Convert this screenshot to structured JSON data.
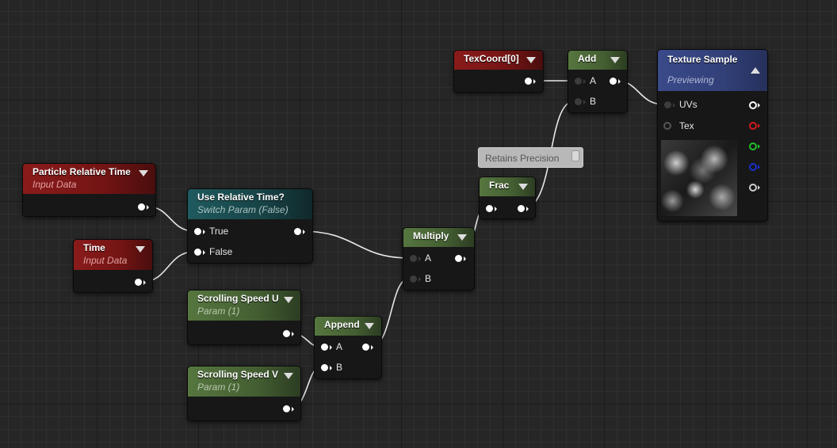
{
  "nodes": {
    "particle_relative_time": {
      "title": "Particle Relative Time",
      "subtitle": "Input Data"
    },
    "time": {
      "title": "Time",
      "subtitle": "Input Data"
    },
    "use_relative_time": {
      "title": "Use Relative Time?",
      "subtitle": "Switch Param (False)",
      "pin_true": "True",
      "pin_false": "False"
    },
    "scrolling_speed_u": {
      "title": "Scrolling Speed U",
      "subtitle": "Param (1)"
    },
    "scrolling_speed_v": {
      "title": "Scrolling Speed V",
      "subtitle": "Param (1)"
    },
    "append": {
      "title": "Append",
      "pin_a": "A",
      "pin_b": "B"
    },
    "multiply": {
      "title": "Multiply",
      "pin_a": "A",
      "pin_b": "B"
    },
    "frac": {
      "title": "Frac"
    },
    "texcoord": {
      "title": "TexCoord[0]"
    },
    "add": {
      "title": "Add",
      "pin_a": "A",
      "pin_b": "B"
    },
    "texture_sample": {
      "title": "Texture Sample",
      "subtitle": "Previewing",
      "pin_uvs": "UVs",
      "pin_tex": "Tex"
    }
  },
  "comment": {
    "text": "Retains Precision"
  },
  "colors": {
    "input_header": "#8a1b1b",
    "switch_header": "#1f5a5e",
    "math_header": "#56763f",
    "texture_header": "#3a4a8a",
    "output_red": "#d21a1a",
    "output_green": "#22c02c",
    "output_blue": "#1a2fd0"
  }
}
